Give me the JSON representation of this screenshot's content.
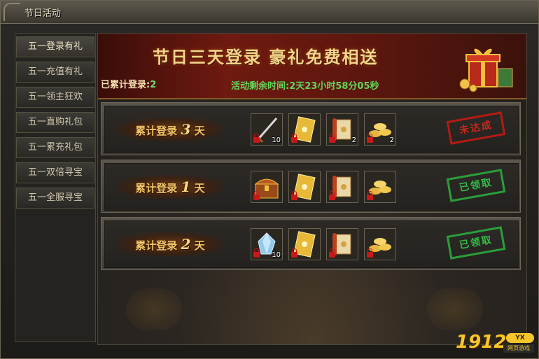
{
  "window": {
    "title": "节日活动"
  },
  "sidebar": {
    "items": [
      {
        "label": "五一登录有礼",
        "active": true
      },
      {
        "label": "五一充值有礼",
        "active": false
      },
      {
        "label": "五一领主狂欢",
        "active": false
      },
      {
        "label": "五一直购礼包",
        "active": false
      },
      {
        "label": "五一累充礼包",
        "active": false
      },
      {
        "label": "五一双倍寻宝",
        "active": false
      },
      {
        "label": "五一全服寻宝",
        "active": false
      }
    ]
  },
  "banner": {
    "title": "节日三天登录  豪礼免费相送",
    "login_label": "已累计登录:",
    "login_value": "2",
    "countdown": "活动剩余时间:2天23小时58分05秒"
  },
  "rewards": [
    {
      "label_prefix": "累计登录",
      "day": "3",
      "label_suffix": "天",
      "status": "未达成",
      "status_color": "#c8261a",
      "items": [
        {
          "icon": "sword-icon",
          "qty": "10"
        },
        {
          "icon": "gold-ticket-icon",
          "qty": ""
        },
        {
          "icon": "scroll-icon",
          "qty": "2"
        },
        {
          "icon": "gold-ingots-icon",
          "qty": "2"
        }
      ]
    },
    {
      "label_prefix": "累计登录",
      "day": "1",
      "label_suffix": "天",
      "status": "已领取",
      "status_color": "#34b947",
      "items": [
        {
          "icon": "treasure-chest-icon",
          "qty": ""
        },
        {
          "icon": "gold-ticket-icon",
          "qty": ""
        },
        {
          "icon": "scroll-icon",
          "qty": ""
        },
        {
          "icon": "gold-ingots-icon",
          "qty": ""
        }
      ]
    },
    {
      "label_prefix": "累计登录",
      "day": "2",
      "label_suffix": "天",
      "status": "已领取",
      "status_color": "#34b947",
      "items": [
        {
          "icon": "blue-crystal-icon",
          "qty": "10"
        },
        {
          "icon": "gold-ticket-icon",
          "qty": ""
        },
        {
          "icon": "scroll-icon",
          "qty": ""
        },
        {
          "icon": "gold-ingots-icon",
          "qty": ""
        }
      ]
    }
  ],
  "watermark": {
    "number": "1912",
    "badge": "YX",
    "sub": "网页游戏"
  }
}
